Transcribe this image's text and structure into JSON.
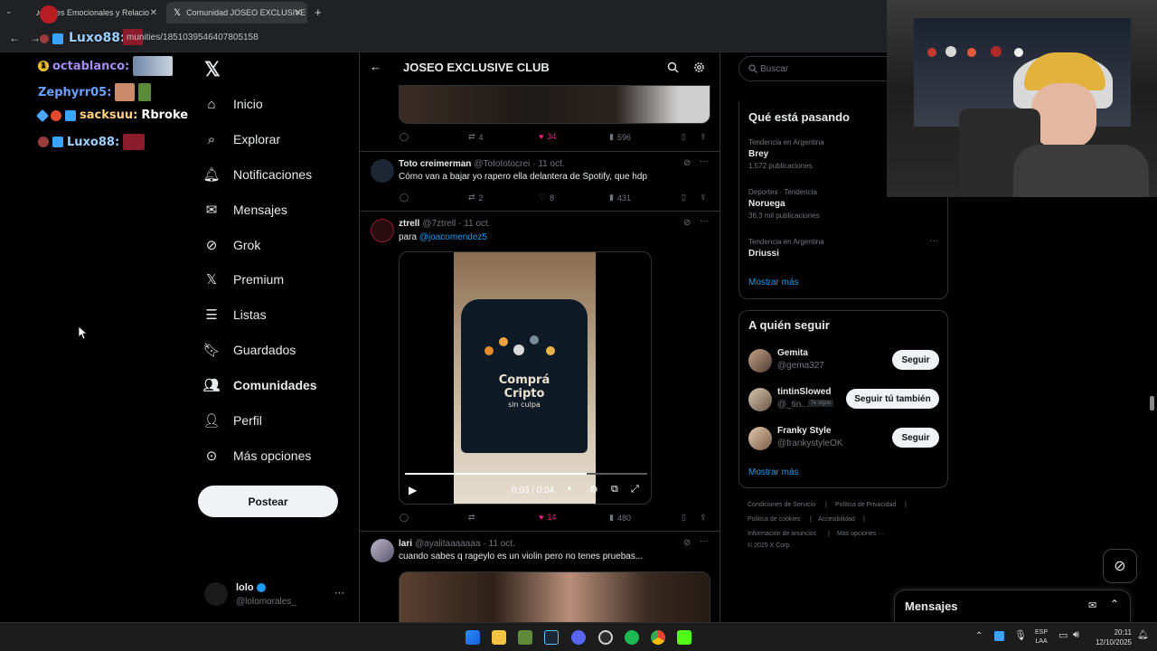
{
  "browser": {
    "tabs": [
      {
        "title": "bres Emocionales y Relacio"
      },
      {
        "title": "Comunidad JOSEO EXCLUSIVE"
      }
    ],
    "new_tab": "+",
    "url": "munities/1851039546407805158"
  },
  "chat": [
    {
      "user": "octablanco:",
      "color": "#a58cf0",
      "message": ""
    },
    {
      "user": "Zephyrr05:",
      "color": "#6aa1ff",
      "message": ""
    },
    {
      "user": "sacksuu:",
      "color": "#ffd27a",
      "message": "Rbroke"
    },
    {
      "user": "Luxo88:",
      "color": "#9ad0ff",
      "message": ""
    }
  ],
  "overlay_user": "Luxo88:",
  "nav": {
    "items": [
      {
        "label": "Inicio",
        "icon": "home-icon"
      },
      {
        "label": "Explorar",
        "icon": "search-icon"
      },
      {
        "label": "Notificaciones",
        "icon": "bell-icon"
      },
      {
        "label": "Mensajes",
        "icon": "mail-icon"
      },
      {
        "label": "Grok",
        "icon": "grok-icon"
      },
      {
        "label": "Premium",
        "icon": "x-logo-icon"
      },
      {
        "label": "Listas",
        "icon": "list-icon"
      },
      {
        "label": "Guardados",
        "icon": "bookmark-icon"
      },
      {
        "label": "Comunidades",
        "icon": "communities-icon"
      },
      {
        "label": "Perfil",
        "icon": "person-icon"
      },
      {
        "label": "Más opciones",
        "icon": "more-circle-icon"
      }
    ],
    "post_button": "Postear",
    "account": {
      "name": "lolo",
      "handle": "@lolomorales_",
      "more": "···"
    }
  },
  "header": {
    "title": "JOSEO EXCLUSIVE CLUB"
  },
  "tweets": [
    {
      "replies": "",
      "retweets": "4",
      "likes": "34",
      "views": "596"
    },
    {
      "name": "Toto creimerman",
      "handle": "@Totototocrei",
      "date": "· 11 oct.",
      "text": "Cómo van a bajar yo rapero ella delantera de Spotify, que hdp",
      "replies": "",
      "retweets": "2",
      "likes": "8",
      "views": "431"
    },
    {
      "name": "ztrell",
      "handle": "@7ztrell",
      "date": "· 11 oct.",
      "text_prefix": "para ",
      "mention": "@joacomendez5",
      "video_time": "0:03 / 0:04",
      "video_progress": 0.75,
      "shirt_text_1": "Comprá",
      "shirt_text_2": "Cripto",
      "shirt_text_3": "sin culpa",
      "replies": "",
      "retweets": "",
      "likes": "14",
      "views": "480"
    },
    {
      "name": "lari",
      "handle": "@ayalitaaaaaaa",
      "date": "· 11 oct.",
      "text": "cuando sabes q rageylo es un violin pero no tenes pruebas..."
    }
  ],
  "search": {
    "placeholder": "Buscar"
  },
  "trends": {
    "title": "Qué está pasando",
    "items": [
      {
        "meta": "Tendencia en Argentina",
        "name": "Brey",
        "count": "1.572 publicaciones"
      },
      {
        "meta": "Deportes · Tendencia",
        "name": "Noruega",
        "count": "36,3 mil publicaciones"
      },
      {
        "meta": "Tendencia en Argentina",
        "name": "Driussi",
        "count": ""
      }
    ],
    "show_more": "Mostrar más",
    "more": "···"
  },
  "who_to_follow": {
    "title": "A quién seguir",
    "items": [
      {
        "name": "Gemita",
        "handle": "@gema327",
        "button": "Seguir",
        "badge": ""
      },
      {
        "name": "tintinSlowed",
        "handle": "@_tin...",
        "button": "Seguir tú también",
        "badge": "Te sigue"
      },
      {
        "name": "Franky Style",
        "handle": "@frankystyleOK",
        "button": "Seguir",
        "badge": ""
      }
    ],
    "show_more": "Mostrar más"
  },
  "footer": {
    "links": [
      "Condiciones de Servicio",
      "Política de Privacidad",
      "Política de cookies",
      "Accesibilidad",
      "Información de anuncios",
      "Más opciones ···"
    ],
    "copyright": "© 2025 X Corp."
  },
  "messages_drawer": {
    "title": "Mensajes"
  },
  "taskbar": {
    "lang": "ESP",
    "lang2": "LAA",
    "time": "20:11",
    "date": "12/10/2025"
  },
  "colors": {
    "accent": "#1d9bf0",
    "like": "#f91880",
    "bg": "#000000",
    "border": "#2f3336"
  }
}
